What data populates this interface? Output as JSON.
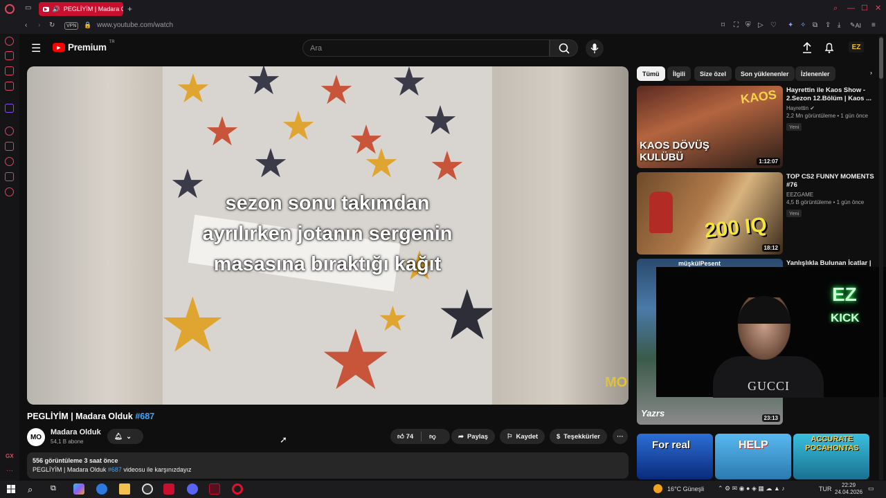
{
  "browser": {
    "tab_title": "PEGLİYİM | Madara Ol",
    "url": "www.youtube.com/watch",
    "vpn_label": "VPN",
    "ai_label": "AI"
  },
  "youtube": {
    "logo": "Premium",
    "logo_badge": "TR",
    "search_placeholder": "Ara"
  },
  "video": {
    "caption_lines": [
      "sezon sonu takımdan",
      "ayrılırken jotanın sergenin",
      "masasına bıraktığı kağıt"
    ],
    "watermark": "MO",
    "title": "PEGLİYİM | Madara Olduk",
    "title_hash": "#687",
    "channel": "Madara Olduk",
    "channel_avatar": "MO",
    "subscribers": "54,1 B abone",
    "likes": "74",
    "share_label": "Paylaş",
    "save_label": "Kaydet",
    "thanks_label": "Teşekkürler",
    "views_line": "556 görüntüleme  3 saat önce",
    "desc_prefix": "PEGLİYİM | Madara Olduk ",
    "desc_hash": "#687",
    "desc_suffix": " videosu ile karşınızdayız"
  },
  "chips": [
    "Tümü",
    "İlgili",
    "Size özel",
    "Son yüklenenler",
    "İzlenenler"
  ],
  "recommendations": [
    {
      "title": "Hayrettin ile Kaos Show - 2.Sezon 12.Bölüm | Kaos ...",
      "channel": "Hayrettin",
      "meta": "2,2 Mn görüntüleme • 1 gün önce",
      "badge": "Yeni",
      "duration": "1:12:07",
      "thumb_text": "KAOS DÖVÜŞ KULÜBÜ",
      "thumb_logo": "KAOS"
    },
    {
      "title": "TOP CS2 FUNNY MOMENTS #76",
      "channel": "EEZGAME",
      "meta": "4,5 B görüntüleme • 1 gün önce",
      "badge": "Yeni",
      "duration": "18:12",
      "thumb_text": "200 IQ"
    },
    {
      "title": "Yanlışlıkla Bulunan İcatlar |",
      "duration": "23:13",
      "thumb_text": "müşkülPesent",
      "thumb_corner": "Yazrs"
    }
  ],
  "shorts": [
    "For real",
    "HELP",
    "ACCURATE POCAHONTAS"
  ],
  "webcam": {
    "neon_logo": "EZ",
    "neon_text": "KICK",
    "shirt_text": "GUCCI"
  },
  "taskbar": {
    "weather": "16°C  Güneşli",
    "lang": "TUR",
    "time": "22:29",
    "date": "24.04.2026"
  }
}
